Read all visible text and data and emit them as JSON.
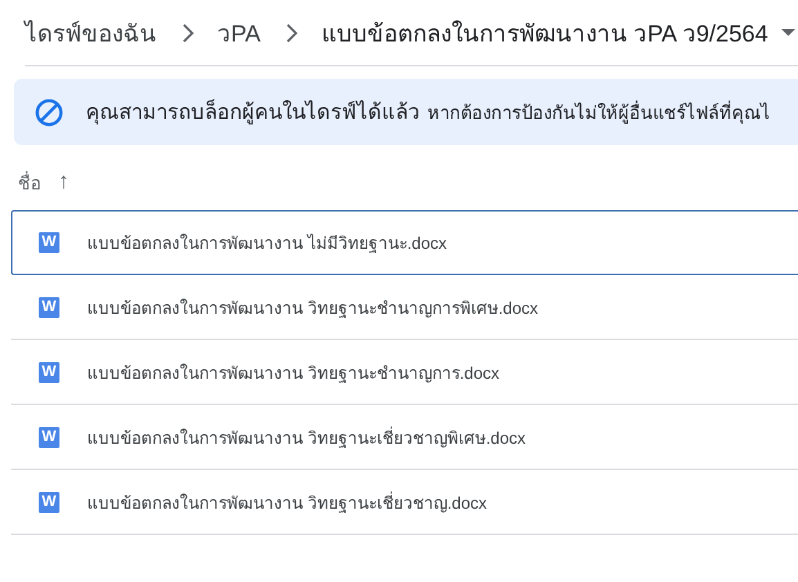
{
  "breadcrumb": [
    {
      "label": "ไดรฟ์ของฉัน"
    },
    {
      "label": "วPA"
    },
    {
      "label": "แบบข้อตกลงในการพัฒนางาน วPA ว9/2564",
      "current": true
    }
  ],
  "banner": {
    "title": "คุณสามารถบล็อกผู้คนในไดรฟ์ได้แล้ว",
    "text": "หากต้องการป้องกันไม่ให้ผู้อื่นแชร์ไฟล์ที่คุณไ"
  },
  "list_header": {
    "label": "ชื่อ",
    "sort_arrow": "↑"
  },
  "files": [
    {
      "icon": "W",
      "name": "แบบข้อตกลงในการพัฒนางาน ไม่มีวิทยฐานะ.docx",
      "selected": true
    },
    {
      "icon": "W",
      "name": "แบบข้อตกลงในการพัฒนางาน วิทยฐานะชำนาญการพิเศษ.docx",
      "selected": false
    },
    {
      "icon": "W",
      "name": "แบบข้อตกลงในการพัฒนางาน วิทยฐานะชำนาญการ.docx",
      "selected": false
    },
    {
      "icon": "W",
      "name": "แบบข้อตกลงในการพัฒนางาน วิทยฐานะเชี่ยวชาญพิเศษ.docx",
      "selected": false
    },
    {
      "icon": "W",
      "name": "แบบข้อตกลงในการพัฒนางาน วิทยฐานะเชี่ยวชาญ.docx",
      "selected": false
    }
  ]
}
